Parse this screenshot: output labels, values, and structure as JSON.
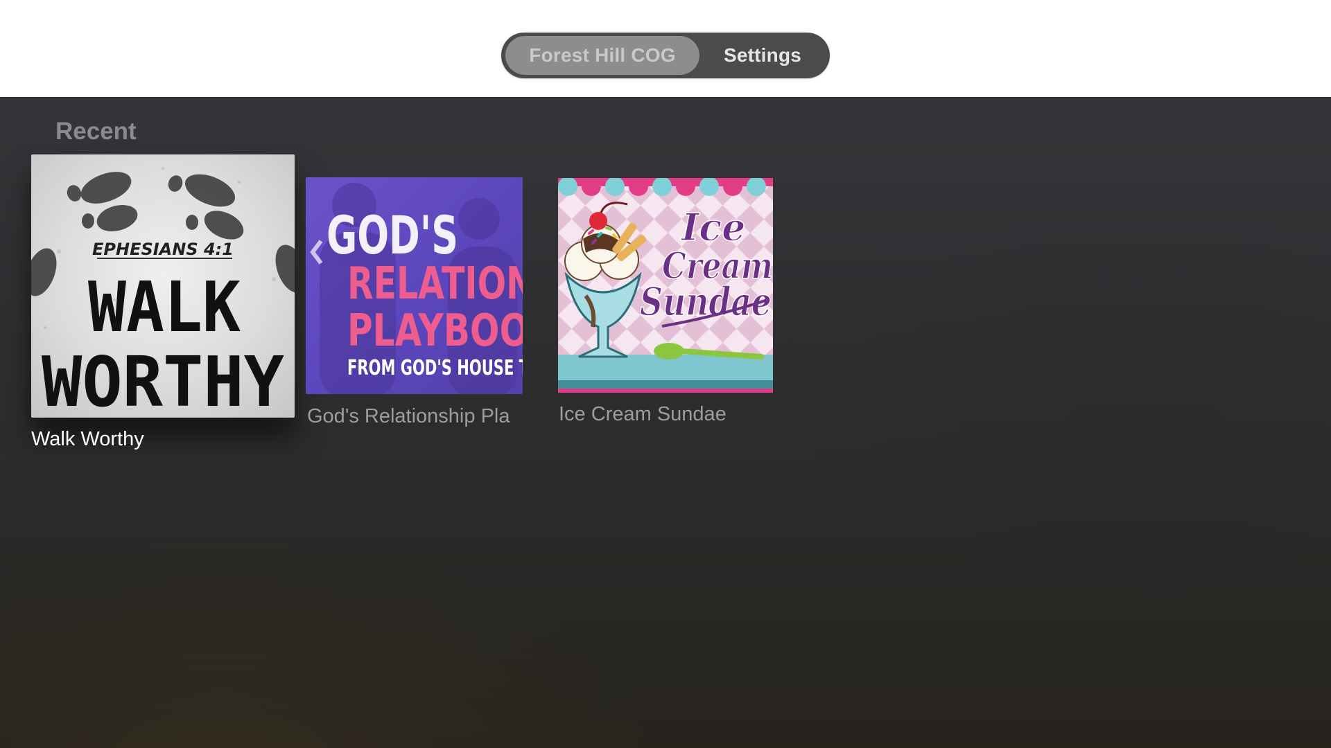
{
  "tabs": {
    "home_label": "Forest Hill COG",
    "settings_label": "Settings"
  },
  "recent": {
    "title": "Recent",
    "items": [
      {
        "caption": "Walk Worthy",
        "art": {
          "line1": "EPHESIANS 4:1",
          "line2": "WALK",
          "line3": "WORTHY"
        }
      },
      {
        "caption": "God's Relationship Pla",
        "art": {
          "line1": "GOD'S",
          "line2": "RELATION",
          "line3": "PLAYBOO",
          "line4": "FROM GOD'S HOUSE T"
        }
      },
      {
        "caption": "Ice Cream Sundae",
        "art": {
          "line1": "Ice",
          "line2": "Cream",
          "line3": "Sundae"
        }
      }
    ]
  },
  "colors": {
    "tabbar_bg": "#4b4b4d",
    "tab_selected_bg": "#8d8d90",
    "background_top": "#333538",
    "background_bottom": "#27241e",
    "accent_pink": "#ee5d8d",
    "accent_purple": "#6b2f86"
  }
}
